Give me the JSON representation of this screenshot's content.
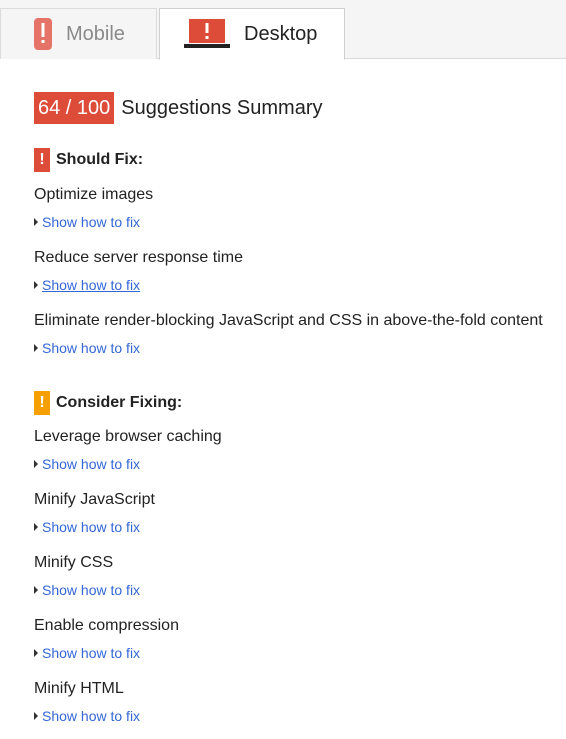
{
  "tabs": [
    {
      "label": "Mobile",
      "icon": "mobile-phone-alert-icon",
      "active": false
    },
    {
      "label": "Desktop",
      "icon": "desktop-monitor-alert-icon",
      "active": true
    }
  ],
  "summary": {
    "score": "64 / 100",
    "title": "Suggestions Summary"
  },
  "should_fix": {
    "badge": "!",
    "heading": "Should Fix:",
    "items": [
      {
        "title": "Optimize images",
        "link": "Show how to fix"
      },
      {
        "title": "Reduce server response time",
        "link": "Show how to fix"
      },
      {
        "title": "Eliminate render-blocking JavaScript and CSS in above-the-fold content",
        "link": "Show how to fix"
      }
    ]
  },
  "consider_fixing": {
    "badge": "!",
    "heading": "Consider Fixing:",
    "items": [
      {
        "title": "Leverage browser caching",
        "link": "Show how to fix"
      },
      {
        "title": "Minify JavaScript",
        "link": "Show how to fix"
      },
      {
        "title": "Minify CSS",
        "link": "Show how to fix"
      },
      {
        "title": "Enable compression",
        "link": "Show how to fix"
      },
      {
        "title": "Minify HTML",
        "link": "Show how to fix"
      }
    ]
  },
  "colors": {
    "score_bg": "#dd4b39",
    "should_fix_badge": "#dd4b39",
    "consider_badge": "#f5a000",
    "link": "#3367d6"
  }
}
